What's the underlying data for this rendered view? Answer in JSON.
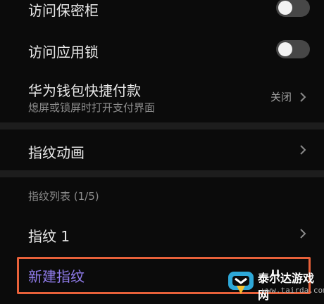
{
  "rows": {
    "safe_box": {
      "label": "访问保密柜",
      "toggle_on": false
    },
    "app_lock": {
      "label": "访问应用锁",
      "toggle_on": false
    },
    "wallet": {
      "label": "华为钱包快捷付款",
      "subtitle": "熄屏或锁屏时打开支付界面",
      "value": "关闭"
    },
    "animation": {
      "label": "指纹动画"
    }
  },
  "fingerprint_list": {
    "title": "指纹列表 (1/5)",
    "items": [
      {
        "label": "指纹 1"
      }
    ],
    "new_label": "新建指纹"
  },
  "highlight_color": "#e8613a",
  "accent_color": "#8f7bea",
  "watermark": {
    "name": "泰尔达游戏网",
    "url": "www.tairda.com"
  }
}
